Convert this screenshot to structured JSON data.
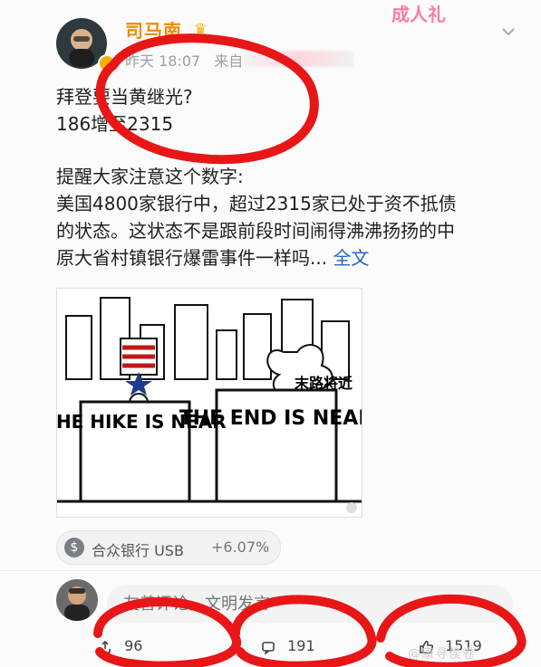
{
  "user": {
    "name": "司马南",
    "time_partial": "昨天 18:07",
    "source_partial": "来自"
  },
  "header": {
    "sticker_text": "成人礼"
  },
  "post": {
    "lines": [
      "拜登要当黄继光?",
      "186增至2315",
      "提醒大家注意这个数字:",
      "美国4800家银行中，超过2315家已处于资不抵债",
      "的状态。这状态不是跟前段时间闹得沸沸扬扬的中",
      "原大省村镇银行爆雷事件一样吗..."
    ],
    "full_text_label": "全文"
  },
  "cartoon": {
    "left_sign_text": "THE HIKE IS NEAR",
    "right_sign_text": "THE END IS NEAR",
    "right_side_text": "末路将近"
  },
  "stock": {
    "icon": "dollar-icon",
    "name": "合众银行 USB",
    "change": "+6.07%"
  },
  "comment": {
    "placeholder": "友善评论，文明发言"
  },
  "actions": {
    "share_count": "96",
    "comment_count": "191",
    "like_count": "1519"
  },
  "watermark": {
    "text": "@康寻侯卷"
  },
  "colors": {
    "username_orange": "#f08a00",
    "fulltext_blue": "#2c64c5",
    "annotation_red": "#e81616"
  }
}
